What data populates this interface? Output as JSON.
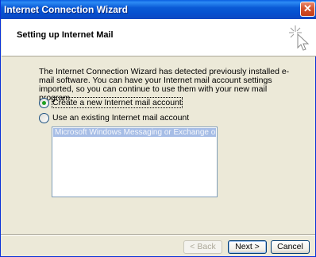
{
  "window": {
    "title": "Internet Connection Wizard",
    "close_symbol": "✕"
  },
  "header": {
    "title": "Setting up Internet Mail",
    "icon": "wizard-sparkle-cursor-icon"
  },
  "description": "The Internet Connection Wizard has detected previously installed e-mail software. You can have your Internet mail account settings imported, so you can continue to use them with your new mail program.",
  "options": [
    {
      "label": "Create a new Internet mail account",
      "checked": true
    },
    {
      "label": "Use an existing Internet mail account",
      "checked": false
    }
  ],
  "account_list": {
    "items": [
      "Microsoft Windows Messaging or Exchange or Outlook"
    ],
    "selected_index": 0
  },
  "buttons": {
    "back": "< Back",
    "next": "Next >",
    "cancel": "Cancel"
  },
  "colors": {
    "titlebar": "#0a5ad6",
    "close_button": "#d4542f",
    "selection": "#a6bde6",
    "radio_dot": "#21a121"
  }
}
